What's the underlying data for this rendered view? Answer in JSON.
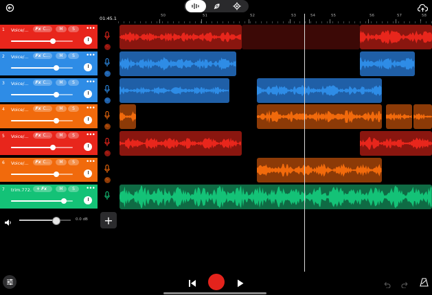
{
  "colors": {
    "red": "#e8261c",
    "blue": "#2e8ce6",
    "orange": "#f16a0c",
    "green": "#14c277",
    "red_clip": "#8a160f",
    "red_clip_dark": "#3c0906",
    "blue_clip": "#1f5fa7",
    "orange_clip": "#8c3a07",
    "green_clip": "#0f6b44"
  },
  "toolbar": {
    "back_icon": "undo-arrow-icon",
    "mode_icons": [
      "waveform-icon",
      "feather-icon",
      "gear-icon"
    ],
    "upload_icon": "cloud-upload-icon"
  },
  "timeline": {
    "position": "01:45.1",
    "bar_labels": [
      "50",
      "51",
      "52",
      "53",
      "54",
      "55",
      "56",
      "57",
      "58"
    ],
    "playhead_fraction": 0.592
  },
  "tracks": [
    {
      "num": "1",
      "name": "Voice/...",
      "fx": "Fx",
      "fx_text": "C...",
      "mute": "M",
      "solo": "S",
      "volume": 0.68,
      "color": "red"
    },
    {
      "num": "2",
      "name": "Voice/...",
      "fx": "Fx",
      "fx_text": "C...",
      "mute": "M",
      "solo": "S",
      "volume": 0.73,
      "color": "blue"
    },
    {
      "num": "3",
      "name": "Voice/...",
      "fx": "Fx",
      "fx_text": "C...",
      "mute": "M",
      "solo": "S",
      "volume": 0.73,
      "color": "blue"
    },
    {
      "num": "4",
      "name": "Voice/...",
      "fx": "Fx",
      "fx_text": "C...",
      "mute": "M",
      "solo": "S",
      "volume": 0.73,
      "color": "orange"
    },
    {
      "num": "5",
      "name": "Voice/...",
      "fx": "Fx",
      "fx_text": "C...",
      "mute": "M",
      "solo": "S",
      "volume": 0.68,
      "color": "red"
    },
    {
      "num": "6",
      "name": "Voice/...",
      "fx": "Fx",
      "fx_text": "C...",
      "mute": "M",
      "solo": "S",
      "volume": 0.73,
      "color": "orange"
    },
    {
      "num": "7",
      "name": "trim.772...",
      "fx": "+ Fx",
      "fx_text": "",
      "mute": "M",
      "solo": "S",
      "volume": 0.86,
      "color": "green"
    }
  ],
  "master": {
    "volume": 0.72,
    "db": "0.0 dB"
  },
  "bottom": {
    "mixer_icon": "sliders-icon",
    "rewind_icon": "skip-back-icon",
    "record_icon": "record-icon",
    "play_icon": "play-icon",
    "undo_icon": "undo-icon",
    "redo_icon": "redo-icon",
    "metronome_icon": "metronome-icon",
    "add_label": "+"
  }
}
